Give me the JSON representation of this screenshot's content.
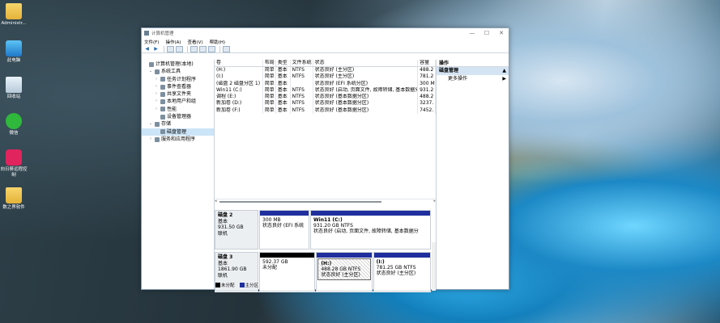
{
  "desktop": {
    "icons": [
      {
        "label": "Administr...",
        "icon": "folder-icon"
      },
      {
        "label": "此电脑",
        "icon": "computer-icon"
      },
      {
        "label": "回收站",
        "icon": "recycle-bin-icon"
      },
      {
        "label": "微信",
        "icon": "wechat-icon"
      },
      {
        "label": "向日葵远程控制",
        "icon": "todesk-icon"
      },
      {
        "label": "数之界软件",
        "icon": "folder-icon"
      }
    ]
  },
  "window": {
    "title": "计算机管理",
    "controls": {
      "minimize": "—",
      "maximize": "☐",
      "close": "✕"
    },
    "menu": [
      "文件(F)",
      "操作(A)",
      "查看(V)",
      "帮助(H)"
    ]
  },
  "tree": {
    "items": [
      {
        "label": "计算机管理(本地)",
        "arrow": "",
        "indent": 0
      },
      {
        "label": "系统工具",
        "arrow": "⌄",
        "indent": 1
      },
      {
        "label": "任务计划程序",
        "arrow": "›",
        "indent": 2
      },
      {
        "label": "事件查看器",
        "arrow": "›",
        "indent": 2
      },
      {
        "label": "共享文件夹",
        "arrow": "›",
        "indent": 2
      },
      {
        "label": "本地用户和组",
        "arrow": "›",
        "indent": 2
      },
      {
        "label": "性能",
        "arrow": "›",
        "indent": 2
      },
      {
        "label": "设备管理器",
        "arrow": "",
        "indent": 2
      },
      {
        "label": "存储",
        "arrow": "⌄",
        "indent": 1
      },
      {
        "label": "磁盘管理",
        "arrow": "",
        "indent": 2,
        "selected": true
      },
      {
        "label": "服务和应用程序",
        "arrow": "›",
        "indent": 1
      }
    ]
  },
  "volumes": {
    "columns": [
      "卷",
      "布局",
      "类型",
      "文件系统",
      "状态",
      "容量"
    ],
    "rows": [
      [
        "(H:)",
        "简单",
        "基本",
        "NTFS",
        "状态良好 (主分区)",
        "488.2"
      ],
      [
        "(I:)",
        "简单",
        "基本",
        "NTFS",
        "状态良好 (主分区)",
        "781.2"
      ],
      [
        "(磁盘 2 磁盘分区 1)",
        "简单",
        "基本",
        "",
        "状态良好 (EFI 系统分区)",
        "300 M"
      ],
      [
        "Win11 (C:)",
        "简单",
        "基本",
        "NTFS",
        "状态良好 (启动, 页面文件, 故障转储, 基本数据分区)",
        "931.2"
      ],
      [
        "调程 (E:)",
        "简单",
        "基本",
        "NTFS",
        "状态良好 (基本数据分区)",
        "488.2"
      ],
      [
        "新加卷 (D:)",
        "简单",
        "基本",
        "NTFS",
        "状态良好 (基本数据分区)",
        "3237."
      ],
      [
        "新加卷 (F:)",
        "简单",
        "基本",
        "NTFS",
        "状态良好 (基本数据分区)",
        "7452."
      ]
    ]
  },
  "disks": [
    {
      "name": "磁盘 2",
      "type": "基本",
      "size": "931.50 GB",
      "status": "联机",
      "partitions": [
        {
          "title": "",
          "line1": "300 MB",
          "line2": "状态良好 (EFI 系统",
          "color": "#1f2f9e",
          "width_share": 0.29,
          "selected": false
        },
        {
          "title": "Win11  (C:)",
          "line1": "931.20 GB NTFS",
          "line2": "状态良好 (启动, 页面文件, 故障转储, 基本数据分",
          "color": "#1f2f9e",
          "width_share": 0.71,
          "selected": false
        }
      ]
    },
    {
      "name": "磁盘 3",
      "type": "基本",
      "size": "1861.90 GB",
      "status": "联机",
      "partitions": [
        {
          "title": "",
          "line1": "592.37 GB",
          "line2": "未分配",
          "color": "#000000",
          "width_share": 0.33,
          "selected": false
        },
        {
          "title": "(H:)",
          "line1": "488.28 GB NTFS",
          "line2": "状态良好 (主分区)",
          "color": "#1f2f9e",
          "width_share": 0.33,
          "selected": true
        },
        {
          "title": "(I:)",
          "line1": "781.25 GB NTFS",
          "line2": "状态良好 (主分区)",
          "color": "#1f2f9e",
          "width_share": 0.34,
          "selected": false
        }
      ]
    }
  ],
  "legend": [
    {
      "label": "未分配",
      "color": "#000000"
    },
    {
      "label": "主分区",
      "color": "#1f2f9e"
    }
  ],
  "ops": {
    "header": "操作",
    "section": "磁盘管理",
    "section_arrow": "▲",
    "item": "更多操作",
    "item_arrow": "▶"
  }
}
